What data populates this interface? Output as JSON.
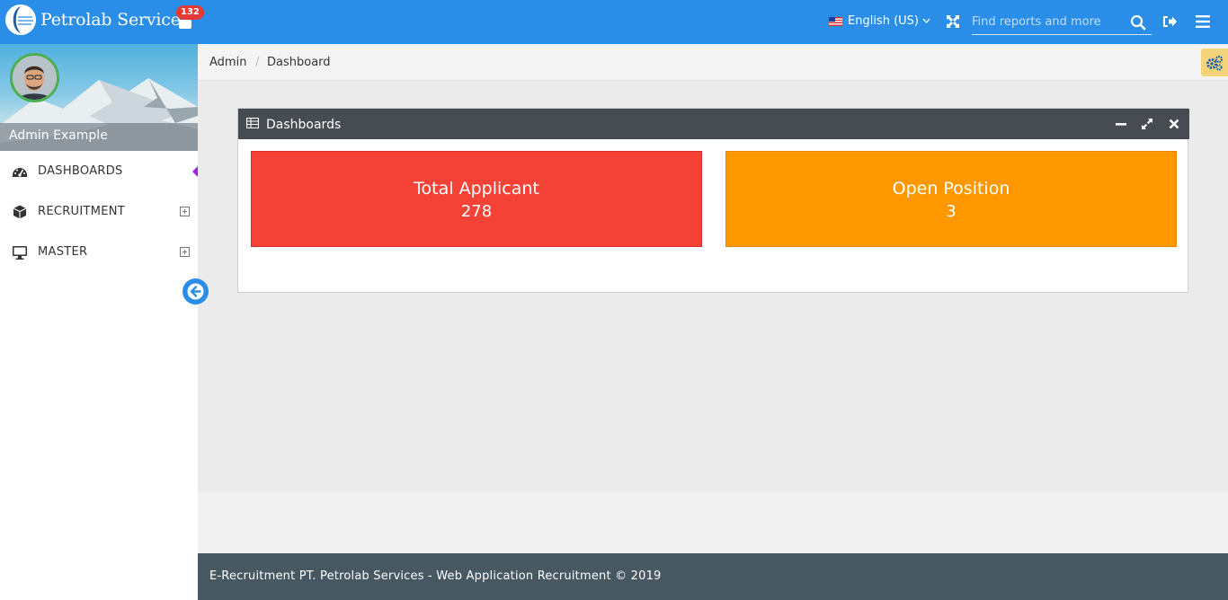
{
  "header": {
    "brand": "Petrolab Services",
    "notification_count": "132",
    "language": "English (US)",
    "search_placeholder": "Find reports and more"
  },
  "sidebar": {
    "user_name": "Admin Example",
    "items": [
      {
        "label": "DASHBOARDS",
        "icon": "dashboard-icon"
      },
      {
        "label": "RECRUITMENT",
        "icon": "cube-icon",
        "expandable": true
      },
      {
        "label": "MASTER",
        "icon": "desktop-icon",
        "expandable": true
      }
    ]
  },
  "breadcrumb": {
    "items": [
      "Admin",
      "Dashboard"
    ]
  },
  "widget": {
    "title": "Dashboards",
    "stats": [
      {
        "label": "Total Applicant",
        "value": "278",
        "color": "#f44336"
      },
      {
        "label": "Open Position",
        "value": "3",
        "color": "#ff9800"
      }
    ]
  },
  "footer": {
    "text": "E-Recruitment PT. Petrolab Services - Web Application Recruitment © 2019"
  },
  "colors": {
    "header": "#2a8ee8",
    "widget_header": "#474c52",
    "footer": "#475863"
  }
}
